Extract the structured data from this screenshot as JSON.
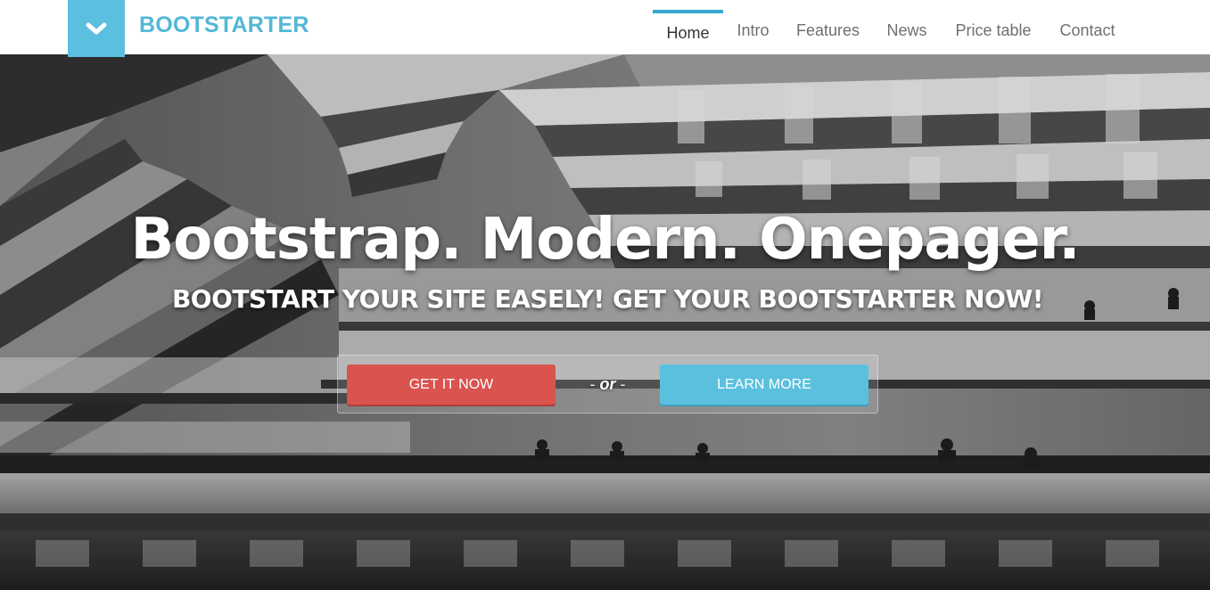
{
  "brand": {
    "name": "BOOTSTARTER",
    "toggle_icon": "chevron-down-icon"
  },
  "nav": {
    "items": [
      {
        "label": "Home",
        "active": true
      },
      {
        "label": "Intro",
        "active": false
      },
      {
        "label": "Features",
        "active": false
      },
      {
        "label": "News",
        "active": false
      },
      {
        "label": "Price table",
        "active": false
      },
      {
        "label": "Contact",
        "active": false
      }
    ]
  },
  "hero": {
    "title": "Bootstrap. Modern. Onepager.",
    "subtitle": "BOOTSTART YOUR SITE EASELY! GET YOUR BOOTSTARTER NOW!",
    "background": "grayscale photo of hotel atrium with balconies and silhouetted people",
    "cta": {
      "primary_label": "GET IT NOW",
      "separator": "or",
      "secondary_label": "LEARN MORE"
    }
  },
  "colors": {
    "accent": "#5bbfdf",
    "brand_text": "#53b7d7",
    "nav_active_bar": "#36a9d1",
    "button_danger": "#d9534f",
    "button_info": "#5bc0de"
  }
}
